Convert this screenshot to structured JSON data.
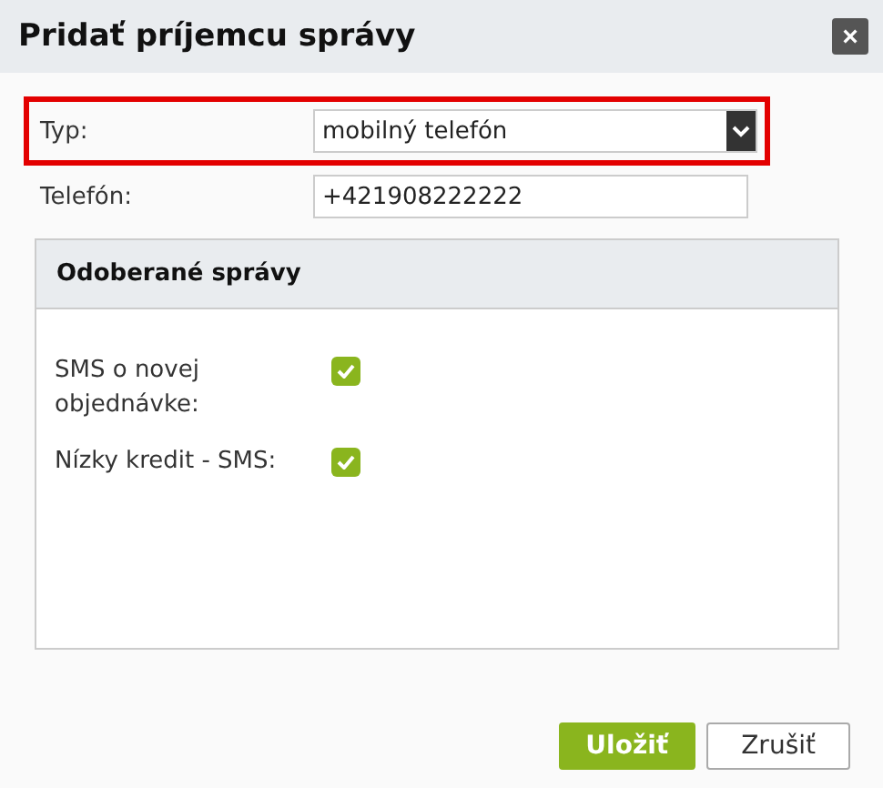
{
  "dialog": {
    "title": "Pridať príjemcu správy",
    "close": "×"
  },
  "fields": [
    {
      "kind": "select",
      "label": "Typ:",
      "value": "mobilný telefón",
      "highlighted": true
    },
    {
      "kind": "text",
      "label": "Telefón:",
      "value": "+421908222222",
      "highlighted": false
    }
  ],
  "panel": {
    "title": "Odoberané správy",
    "items": [
      {
        "label": "SMS o novej objednávke:",
        "checked": true
      },
      {
        "label": "Nízky kredit - SMS:",
        "checked": true
      }
    ]
  },
  "buttons": [
    {
      "kind": "primary",
      "label": "Uložiť"
    },
    {
      "kind": "secondary",
      "label": "Zrušiť"
    }
  ]
}
